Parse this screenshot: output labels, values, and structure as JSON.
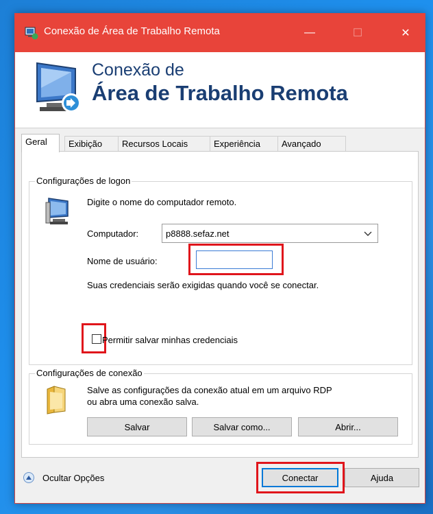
{
  "window": {
    "title": "Conexão de Área de Trabalho Remota",
    "minimize": "—",
    "maximize": "☐",
    "close": "✕"
  },
  "banner": {
    "line1": "Conexão de",
    "line2": "Área de Trabalho Remota"
  },
  "tabs": [
    "Geral",
    "Exibição",
    "Recursos Locais",
    "Experiência",
    "Avançado"
  ],
  "logon": {
    "group_title": "Configurações de logon",
    "instruction": "Digite o nome do computador remoto.",
    "computer_label": "Computador:",
    "computer_value": "p8888.sefaz.net",
    "username_label": "Nome de usuário:",
    "username_value": "",
    "credentials_note": "Suas credenciais serão exigidas quando você se conectar.",
    "save_credentials_label": "Permitir salvar minhas credenciais",
    "save_credentials_checked": false
  },
  "connection": {
    "group_title": "Configurações de conexão",
    "description_line1": "Salve as configurações da conexão atual em um arquivo RDP",
    "description_line2": "ou abra uma conexão salva.",
    "save_button": "Salvar",
    "save_as_button": "Salvar como...",
    "open_button": "Abrir..."
  },
  "footer": {
    "hide_options": "Ocultar Opções",
    "connect_button": "Conectar",
    "help_button": "Ajuda"
  },
  "colors": {
    "titlebar": "#e8443a",
    "highlight": "#e0151b",
    "banner_text": "#1a3e73",
    "focus_border": "#0078d7"
  }
}
